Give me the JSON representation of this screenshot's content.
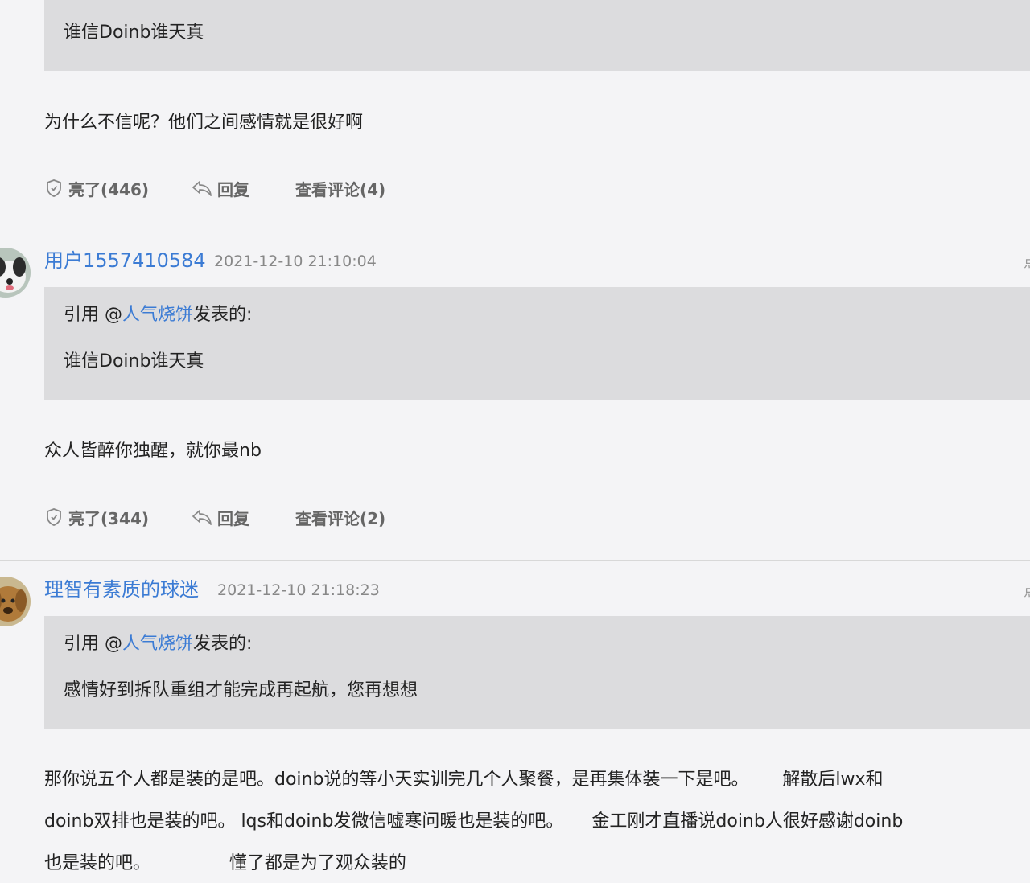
{
  "top_comment": {
    "quote_text": "谁信Doinb谁天真",
    "body": "为什么不信呢？他们之间感情就是很好啊",
    "actions": {
      "like_label": "亮了(446)",
      "reply_label": "回复",
      "view_label": "查看评论(4)"
    }
  },
  "comments": [
    {
      "username": "用户1557410584",
      "timestamp": "2021-12-10 21:10:04",
      "edge_label": "点",
      "quote": {
        "prefix": "引用 @",
        "author": "人气烧饼",
        "suffix": "发表的:",
        "text": "谁信Doinb谁天真"
      },
      "body_lines": [
        "众人皆醉你独醒，就你最nb"
      ],
      "actions": {
        "like_label": "亮了(344)",
        "reply_label": "回复",
        "view_label": "查看评论(2)"
      }
    },
    {
      "username": "理智有素质的球迷",
      "timestamp": "2021-12-10 21:18:23",
      "edge_label": "点",
      "quote": {
        "prefix": "引用 @",
        "author": "人气烧饼",
        "suffix": "发表的:",
        "text": "感情好到拆队重组才能完成再起航，您再想想"
      },
      "body_lines": [
        "那你说五个人都是装的是吧。doinb说的等小天实训完几个人聚餐，是再集体装一下是吧。      解散后lwx和",
        "doinb双排也是装的吧。 lqs和doinb发微信嘘寒问暖也是装的吧。     金工刚才直播说doinb人很好感谢doinb",
        "也是装的吧。              懂了都是为了观众装的"
      ]
    }
  ],
  "icons": {
    "like": "thumb-shield-icon",
    "reply": "reply-arrow-icon"
  },
  "colors": {
    "link": "#3b7bd4",
    "quote_bg": "#dcdcde",
    "page_bg": "#f4f4f6",
    "meta_text": "#888888"
  }
}
